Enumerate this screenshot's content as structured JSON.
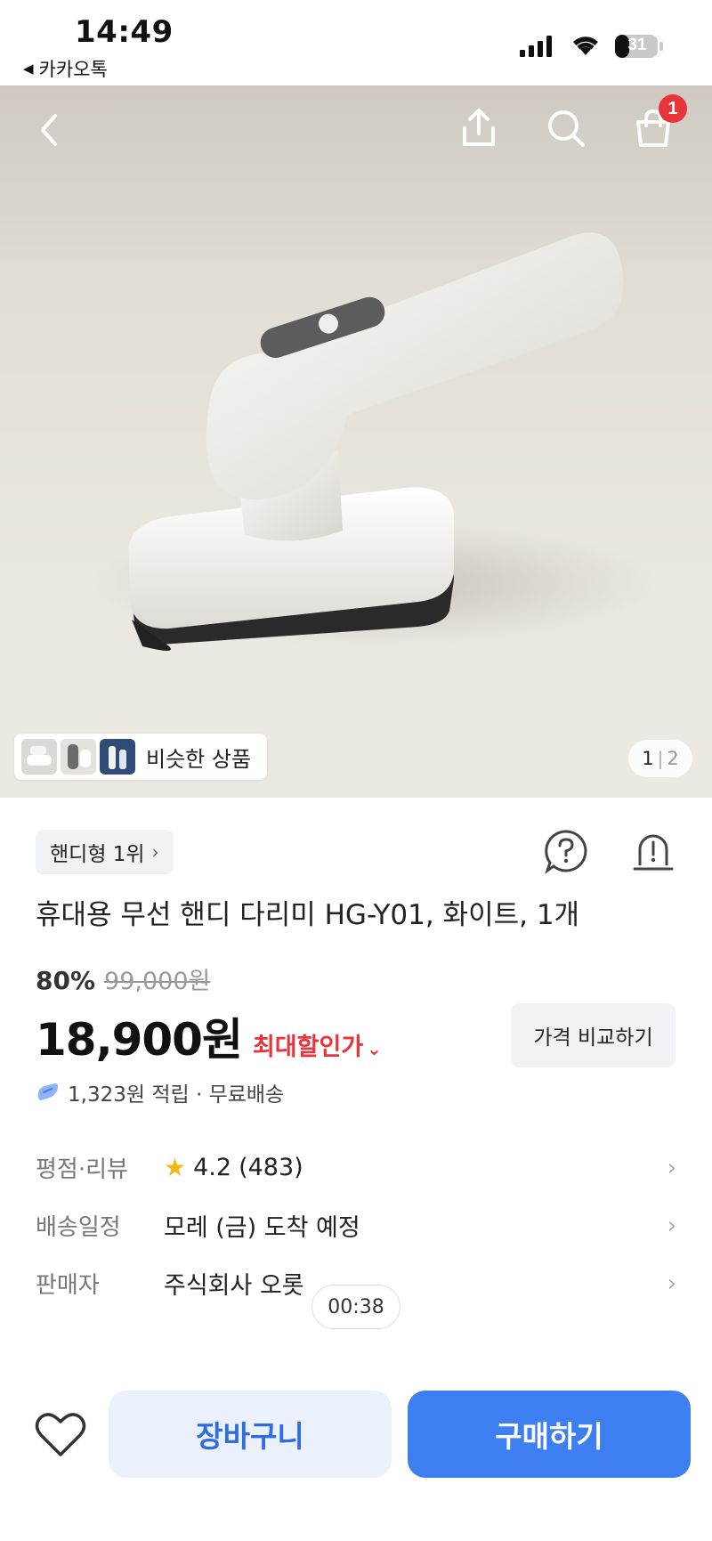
{
  "status_bar": {
    "time": "14:49",
    "back_app": "카카오톡",
    "battery": "31"
  },
  "hero": {
    "cart_badge": "1",
    "similar_label": "비슷한 상품",
    "page_current": "1",
    "page_total": "2",
    "icons": [
      "back-arrow-icon",
      "share-icon",
      "search-icon",
      "cart-icon"
    ]
  },
  "product": {
    "rank_chip": "핸디형 1위",
    "title": "휴대용 무선 핸디 다리미 HG-Y01, 화이트, 1개",
    "discount": "80%",
    "original_price": "99,000원",
    "price": "18,900원",
    "max_discount_label": "최대할인가",
    "compare_button": "가격 비교하기",
    "points": "1,323원 적립 · 무료배송"
  },
  "info": {
    "rating_label": "평점·리뷰",
    "rating_value": "4.2",
    "review_count": "(483)",
    "delivery_label": "배송일정",
    "delivery_value": "모레 (금) 도착 예정",
    "seller_label": "판매자",
    "seller_value": "주식회사 오롯"
  },
  "timer": "00:38",
  "bottom_bar": {
    "cart_button": "장바구니",
    "buy_button": "구매하기"
  },
  "colors": {
    "accent_blue": "#3d7ef0",
    "cart_button_bg": "#eaf1fd",
    "sale_red": "#e8343a",
    "star": "#f5b81c"
  }
}
